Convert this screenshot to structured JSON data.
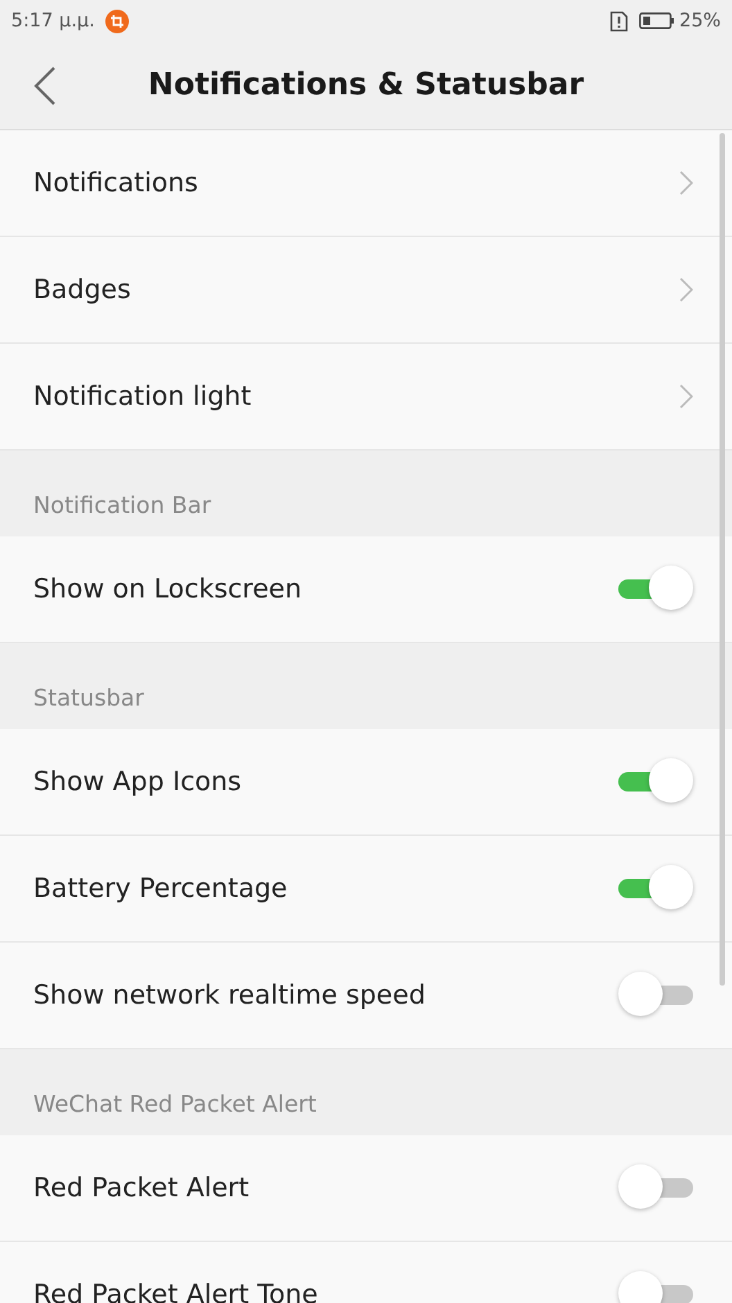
{
  "status_bar": {
    "time": "5:17 μ.μ.",
    "battery_text": "25%"
  },
  "header": {
    "title": "Notifications & Statusbar"
  },
  "items": [
    {
      "kind": "link",
      "label": "Notifications"
    },
    {
      "kind": "link",
      "label": "Badges"
    },
    {
      "kind": "link",
      "label": "Notification light"
    },
    {
      "kind": "section",
      "label": "Notification Bar"
    },
    {
      "kind": "toggle",
      "label": "Show on Lockscreen",
      "on": true
    },
    {
      "kind": "section",
      "label": "Statusbar"
    },
    {
      "kind": "toggle",
      "label": "Show App Icons",
      "on": true
    },
    {
      "kind": "toggle",
      "label": "Battery Percentage",
      "on": true
    },
    {
      "kind": "toggle",
      "label": "Show network realtime speed",
      "on": false
    },
    {
      "kind": "section",
      "label": "WeChat Red Packet Alert"
    },
    {
      "kind": "toggle",
      "label": "Red Packet Alert",
      "on": false
    },
    {
      "kind": "toggle",
      "label": "Red Packet Alert Tone",
      "on": false
    }
  ]
}
